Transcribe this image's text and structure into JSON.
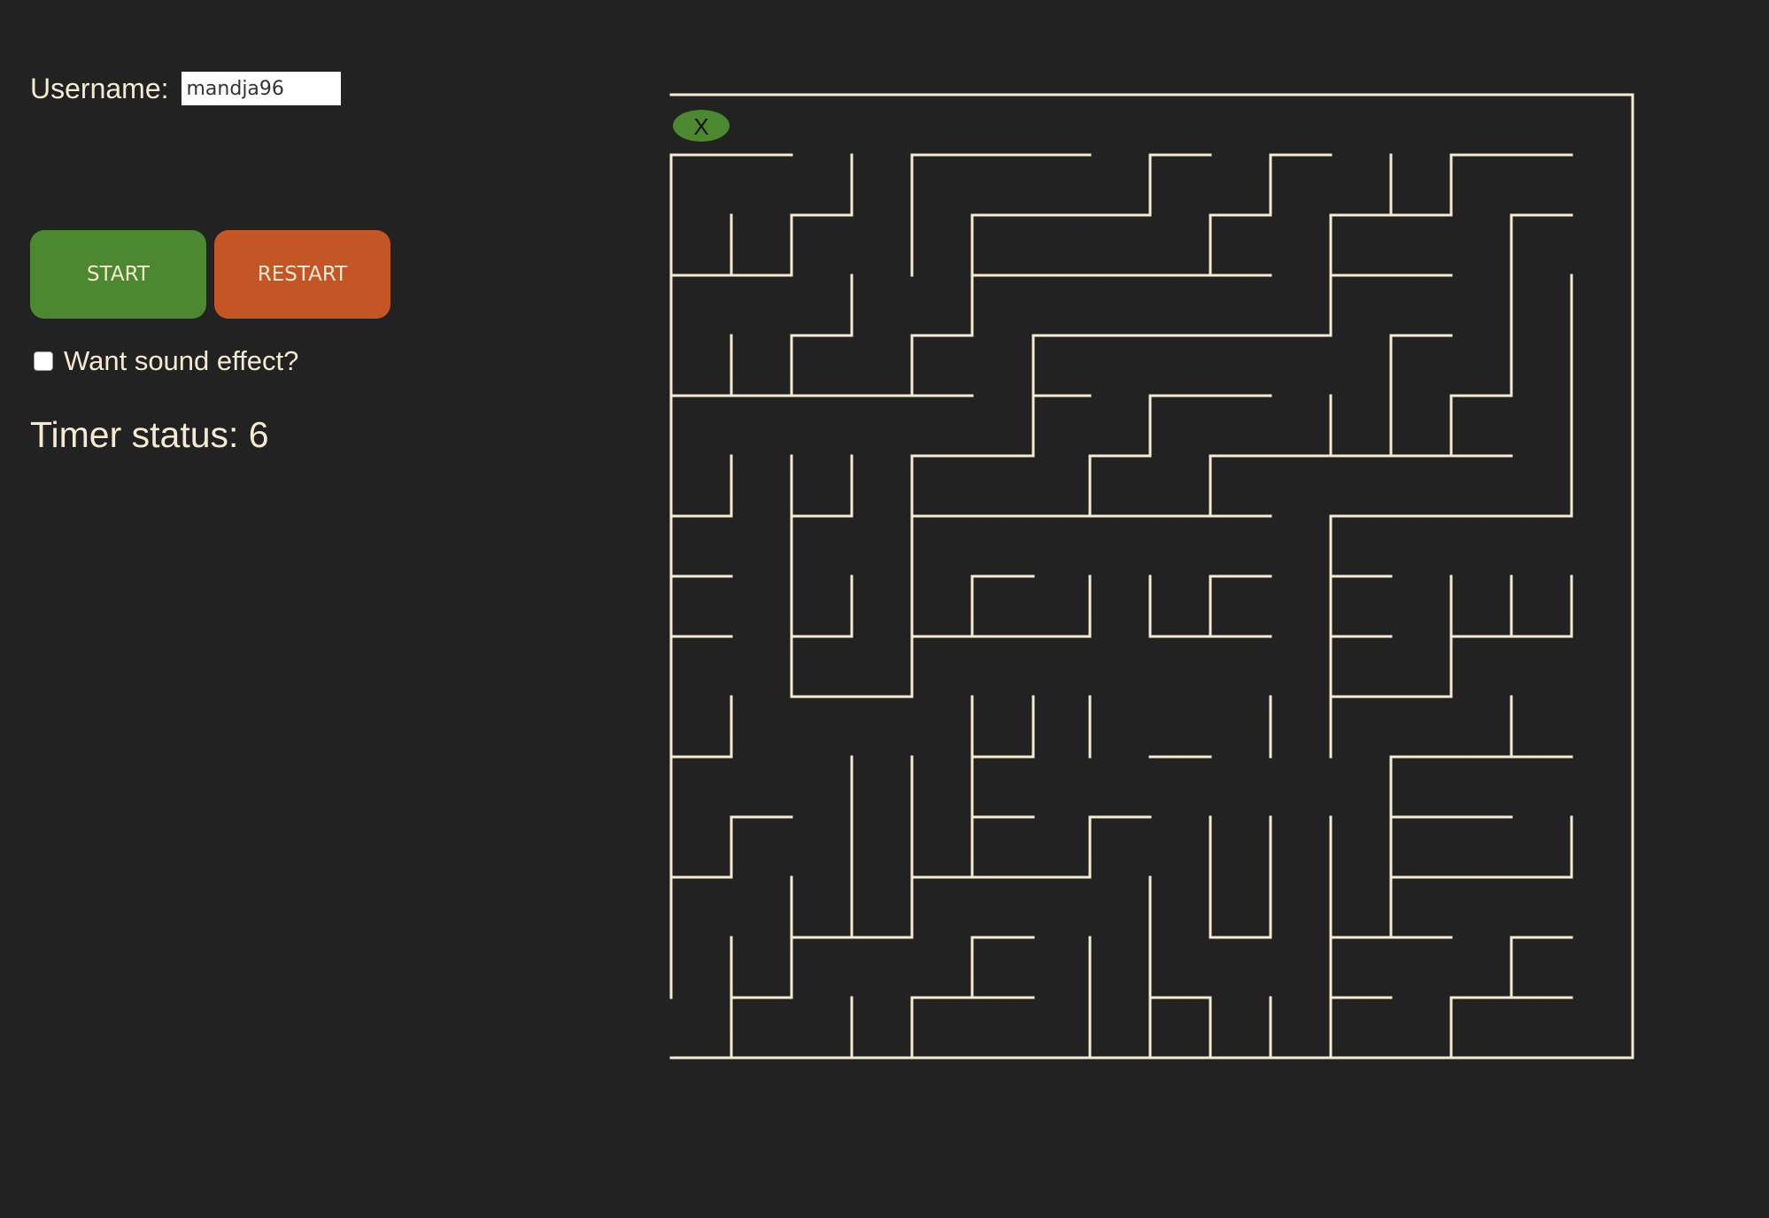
{
  "username": {
    "label": "Username:",
    "value": "mandja96"
  },
  "buttons": {
    "start": "START",
    "restart": "RESTART"
  },
  "sound": {
    "label": "Want sound effect?",
    "checked": false
  },
  "timer": {
    "label": "Timer status: 6"
  },
  "maze": {
    "player_marker": "X",
    "wall_color": "#f5ead2",
    "player_color": "#4b8830"
  },
  "colors": {
    "background": "#222222",
    "text": "#f5ead2",
    "start_button": "#4b8830",
    "restart_button": "#c45626"
  }
}
